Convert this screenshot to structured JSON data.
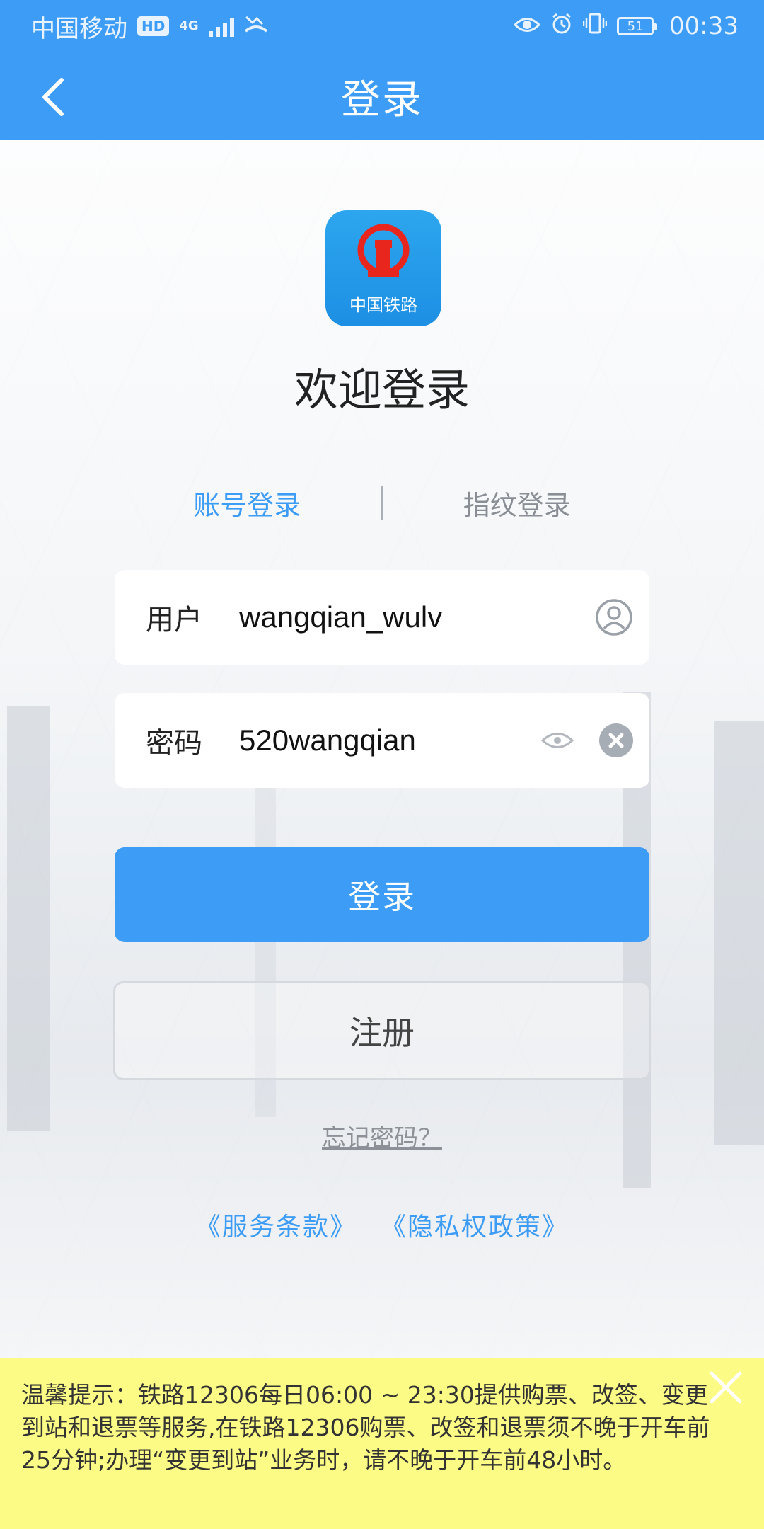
{
  "status_bar": {
    "carrier": "中国移动",
    "hd": "HD",
    "network": "4G",
    "battery": "51",
    "time": "00:33"
  },
  "header": {
    "title": "登录"
  },
  "logo": {
    "text": "中国铁路"
  },
  "welcome": "欢迎登录",
  "tabs": [
    {
      "label": "账号登录",
      "active": true
    },
    {
      "label": "指纹登录",
      "active": false
    }
  ],
  "username": {
    "label": "用户",
    "value": "wangqian_wulv"
  },
  "password": {
    "label": "密码",
    "value": "520wangqian"
  },
  "buttons": {
    "login": "登录",
    "register": "注册"
  },
  "forgot_password": "忘记密码？",
  "links": {
    "terms": "《服务条款》",
    "privacy": "《隐私权政策》"
  },
  "notice": {
    "text": "温馨提示：铁路12306每日06:00 ~ 23:30提供购票、改签、变更到站和退票等服务,在铁路12306购票、改签和退票须不晚于开车前25分钟;办理“变更到站”业务时，请不晚于开车前48小时。"
  },
  "colors": {
    "primary": "#3d9cf5",
    "notice_bg": "#fcfb85"
  }
}
